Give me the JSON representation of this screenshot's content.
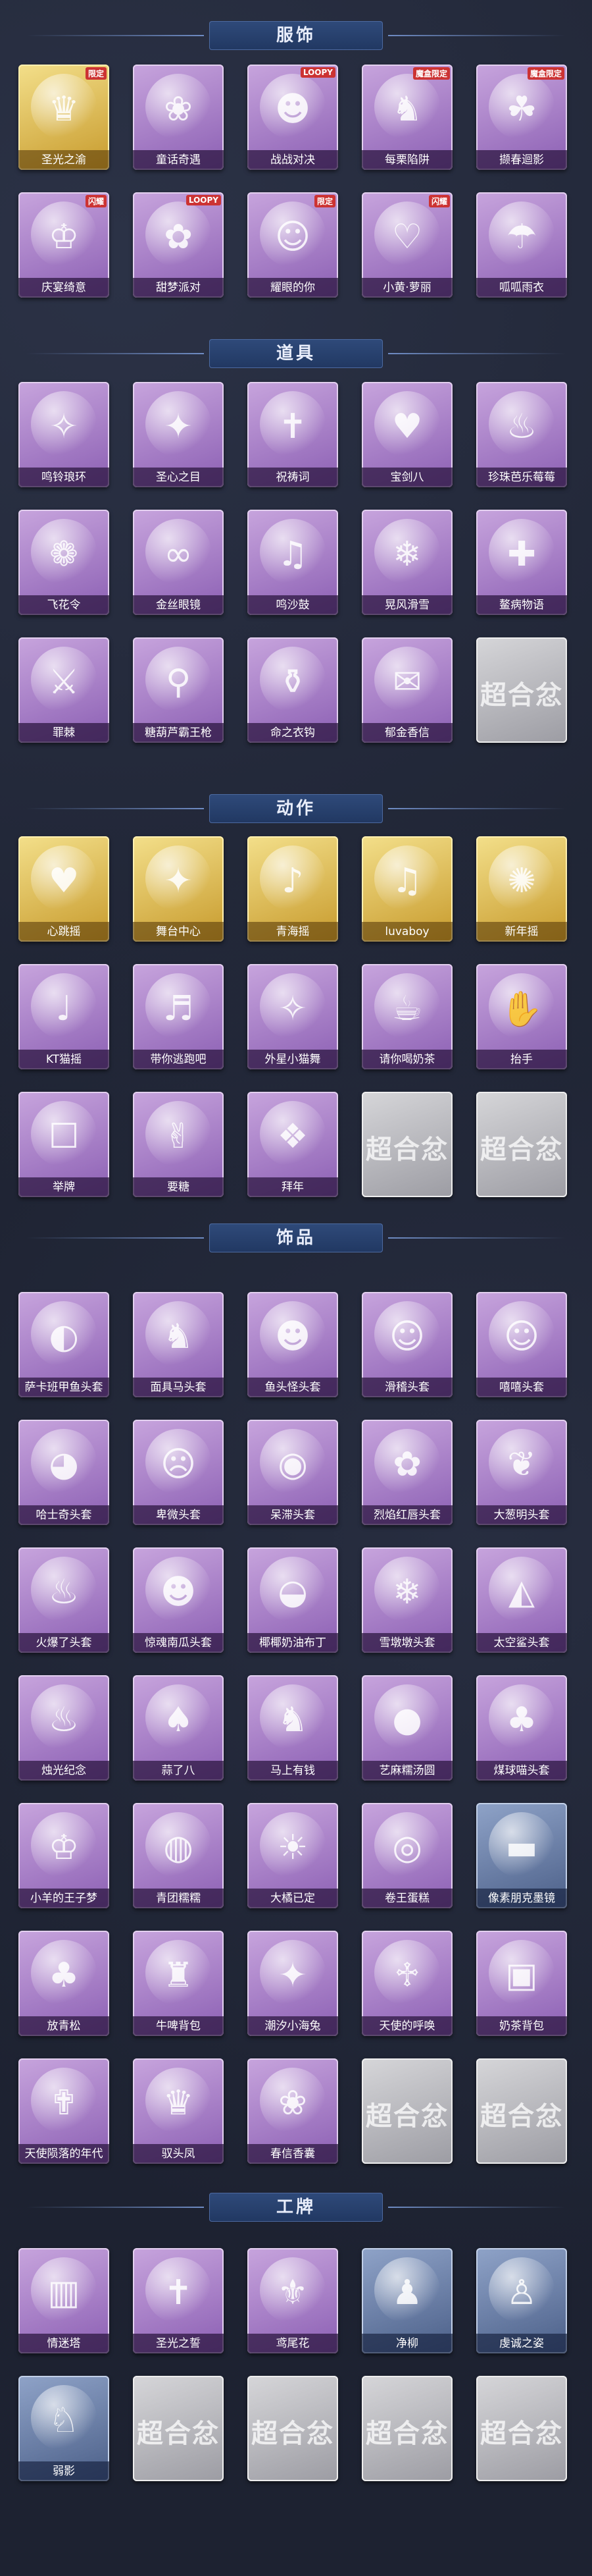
{
  "sections": [
    {
      "title": "服饰",
      "items": [
        {
          "name": "圣光之渝",
          "badge": "限定",
          "tone": "gold",
          "icon": "♛"
        },
        {
          "name": "童话奇遇",
          "badge": "",
          "tone": "purple",
          "icon": "❀"
        },
        {
          "name": "战战对决",
          "badge": "LOOPY",
          "tone": "purple",
          "icon": "☻"
        },
        {
          "name": "每栗陷阱",
          "badge": "魔盒限定",
          "tone": "purple",
          "icon": "♞"
        },
        {
          "name": "撷春迴影",
          "badge": "魔盒限定",
          "tone": "purple",
          "icon": "☘"
        },
        {
          "name": "庆宴绮意",
          "badge": "闪耀",
          "tone": "purple",
          "icon": "♔"
        },
        {
          "name": "甜梦派对",
          "badge": "LOOPY",
          "tone": "purple",
          "icon": "✿"
        },
        {
          "name": "耀眼的你",
          "badge": "限定",
          "tone": "purple",
          "icon": "☺"
        },
        {
          "name": "小黄·萝丽",
          "badge": "闪耀",
          "tone": "purple",
          "icon": "♡"
        },
        {
          "name": "呱呱雨衣",
          "badge": "",
          "tone": "purple",
          "icon": "☂"
        }
      ]
    },
    {
      "title": "道具",
      "items": [
        {
          "name": "鸣铃琅环",
          "badge": "",
          "tone": "purple",
          "icon": "✧"
        },
        {
          "name": "圣心之目",
          "badge": "",
          "tone": "purple",
          "icon": "✦"
        },
        {
          "name": "祝祷词",
          "badge": "",
          "tone": "purple",
          "icon": "✝"
        },
        {
          "name": "宝剑八",
          "badge": "",
          "tone": "purple",
          "icon": "♥"
        },
        {
          "name": "珍珠芭乐莓莓",
          "badge": "",
          "tone": "purple",
          "icon": "♨"
        },
        {
          "name": "飞花令",
          "badge": "",
          "tone": "purple",
          "icon": "❁"
        },
        {
          "name": "金丝眼镜",
          "badge": "",
          "tone": "purple",
          "icon": "∞"
        },
        {
          "name": "鸣沙鼓",
          "badge": "",
          "tone": "purple",
          "icon": "♫"
        },
        {
          "name": "晃风滑雪",
          "badge": "",
          "tone": "purple",
          "icon": "❄"
        },
        {
          "name": "鳌病物语",
          "badge": "",
          "tone": "purple",
          "icon": "✚"
        },
        {
          "name": "罪棘",
          "badge": "",
          "tone": "purple",
          "icon": "⚔"
        },
        {
          "name": "糖葫芦霸王枪",
          "badge": "",
          "tone": "purple",
          "icon": "⚲"
        },
        {
          "name": "命之衣钩",
          "badge": "",
          "tone": "purple",
          "icon": "⚱"
        },
        {
          "name": "郁金香信",
          "badge": "",
          "tone": "purple",
          "icon": "✉"
        },
        {
          "name": "",
          "badge": "",
          "tone": "gray",
          "icon": "",
          "placeholder": "超合忿"
        }
      ]
    },
    {
      "title": "动作",
      "items": [
        {
          "name": "心跳摇",
          "badge": "",
          "tone": "gold",
          "icon": "♥"
        },
        {
          "name": "舞台中心",
          "badge": "",
          "tone": "gold",
          "icon": "✦"
        },
        {
          "name": "青海摇",
          "badge": "",
          "tone": "gold",
          "icon": "♪"
        },
        {
          "name": "luvaboy",
          "badge": "",
          "tone": "gold",
          "icon": "♫"
        },
        {
          "name": "新年摇",
          "badge": "",
          "tone": "gold",
          "icon": "✺"
        },
        {
          "name": "KT猫摇",
          "badge": "",
          "tone": "purple",
          "icon": "♩"
        },
        {
          "name": "带你逃跑吧",
          "badge": "",
          "tone": "purple",
          "icon": "♬"
        },
        {
          "name": "外星小猫舞",
          "badge": "",
          "tone": "purple",
          "icon": "✧"
        },
        {
          "name": "请你喝奶茶",
          "badge": "",
          "tone": "purple",
          "icon": "☕"
        },
        {
          "name": "抬手",
          "badge": "",
          "tone": "purple",
          "icon": "✋"
        },
        {
          "name": "举牌",
          "badge": "",
          "tone": "purple",
          "icon": "☐"
        },
        {
          "name": "要糖",
          "badge": "",
          "tone": "purple",
          "icon": "✌"
        },
        {
          "name": "拜年",
          "badge": "",
          "tone": "purple",
          "icon": "❖"
        },
        {
          "name": "",
          "badge": "",
          "tone": "gray",
          "icon": "",
          "placeholder": "超合忿"
        },
        {
          "name": "",
          "badge": "",
          "tone": "gray",
          "icon": "",
          "placeholder": "超合忿"
        }
      ]
    },
    {
      "title": "饰品",
      "items": [
        {
          "name": "萨卡班甲鱼头套",
          "badge": "",
          "tone": "purple",
          "icon": "◐"
        },
        {
          "name": "面具马头套",
          "badge": "",
          "tone": "purple",
          "icon": "♞"
        },
        {
          "name": "鱼头怪头套",
          "badge": "",
          "tone": "purple",
          "icon": "☻"
        },
        {
          "name": "滑稽头套",
          "badge": "",
          "tone": "purple",
          "icon": "☺"
        },
        {
          "name": "嘻嘻头套",
          "badge": "",
          "tone": "purple",
          "icon": "☺"
        },
        {
          "name": "哈士奇头套",
          "badge": "",
          "tone": "purple",
          "icon": "◕"
        },
        {
          "name": "卑微头套",
          "badge": "",
          "tone": "purple",
          "icon": "☹"
        },
        {
          "name": "呆滞头套",
          "badge": "",
          "tone": "purple",
          "icon": "◉"
        },
        {
          "name": "烈焰红唇头套",
          "badge": "",
          "tone": "purple",
          "icon": "✿"
        },
        {
          "name": "大葱明头套",
          "badge": "",
          "tone": "purple",
          "icon": "❦"
        },
        {
          "name": "火爆了头套",
          "badge": "",
          "tone": "purple",
          "icon": "♨"
        },
        {
          "name": "惊魂南瓜头套",
          "badge": "",
          "tone": "purple",
          "icon": "☻"
        },
        {
          "name": "椰椰奶油布丁",
          "badge": "",
          "tone": "purple",
          "icon": "◒"
        },
        {
          "name": "雪墩墩头套",
          "badge": "",
          "tone": "purple",
          "icon": "❄"
        },
        {
          "name": "太空鲨头套",
          "badge": "",
          "tone": "purple",
          "icon": "◭"
        },
        {
          "name": "烛光纪念",
          "badge": "",
          "tone": "purple",
          "icon": "♨"
        },
        {
          "name": "蒜了八",
          "badge": "",
          "tone": "purple",
          "icon": "♠"
        },
        {
          "name": "马上有钱",
          "badge": "",
          "tone": "purple",
          "icon": "♞"
        },
        {
          "name": "艺麻糯汤圆",
          "badge": "",
          "tone": "purple",
          "icon": "●"
        },
        {
          "name": "煤球喵头套",
          "badge": "",
          "tone": "purple",
          "icon": "♣"
        },
        {
          "name": "小羊的王子梦",
          "badge": "",
          "tone": "purple",
          "icon": "♔"
        },
        {
          "name": "青团糯糯",
          "badge": "",
          "tone": "purple",
          "icon": "◍"
        },
        {
          "name": "大橘已定",
          "badge": "",
          "tone": "purple",
          "icon": "☀"
        },
        {
          "name": "卷王蛋糕",
          "badge": "",
          "tone": "purple",
          "icon": "◎"
        },
        {
          "name": "像素朋克墨镜",
          "badge": "",
          "tone": "blue",
          "icon": "▬"
        },
        {
          "name": "放青松",
          "badge": "",
          "tone": "purple",
          "icon": "♣"
        },
        {
          "name": "牛啤背包",
          "badge": "",
          "tone": "purple",
          "icon": "♜"
        },
        {
          "name": "潮汐小海兔",
          "badge": "",
          "tone": "purple",
          "icon": "✦"
        },
        {
          "name": "天使的呼唤",
          "badge": "",
          "tone": "purple",
          "icon": "♱"
        },
        {
          "name": "奶茶背包",
          "badge": "",
          "tone": "purple",
          "icon": "▣"
        },
        {
          "name": "天使陨落的年代",
          "badge": "",
          "tone": "purple",
          "icon": "✟"
        },
        {
          "name": "驭头凤",
          "badge": "",
          "tone": "purple",
          "icon": "♛"
        },
        {
          "name": "春信香囊",
          "badge": "",
          "tone": "purple",
          "icon": "❀"
        },
        {
          "name": "",
          "badge": "",
          "tone": "gray",
          "icon": "",
          "placeholder": "超合忿"
        },
        {
          "name": "",
          "badge": "",
          "tone": "gray",
          "icon": "",
          "placeholder": "超合忿"
        }
      ]
    },
    {
      "title": "工牌",
      "items": [
        {
          "name": "情迷塔",
          "badge": "",
          "tone": "purple",
          "icon": "▥"
        },
        {
          "name": "圣光之誓",
          "badge": "",
          "tone": "purple",
          "icon": "✝"
        },
        {
          "name": "鸢尾花",
          "badge": "",
          "tone": "purple",
          "icon": "⚜"
        },
        {
          "name": "净柳",
          "badge": "",
          "tone": "blue",
          "icon": "♟"
        },
        {
          "name": "虔诚之姿",
          "badge": "",
          "tone": "blue",
          "icon": "♙"
        },
        {
          "name": "弱影",
          "badge": "",
          "tone": "blue",
          "icon": "♘"
        },
        {
          "name": "",
          "badge": "",
          "tone": "gray",
          "icon": "",
          "placeholder": "超合忿"
        },
        {
          "name": "",
          "badge": "",
          "tone": "gray",
          "icon": "",
          "placeholder": "超合忿"
        },
        {
          "name": "",
          "badge": "",
          "tone": "gray",
          "icon": "",
          "placeholder": "超合忿"
        },
        {
          "name": "",
          "badge": "",
          "tone": "gray",
          "icon": "",
          "placeholder": "超合忿"
        }
      ]
    }
  ]
}
